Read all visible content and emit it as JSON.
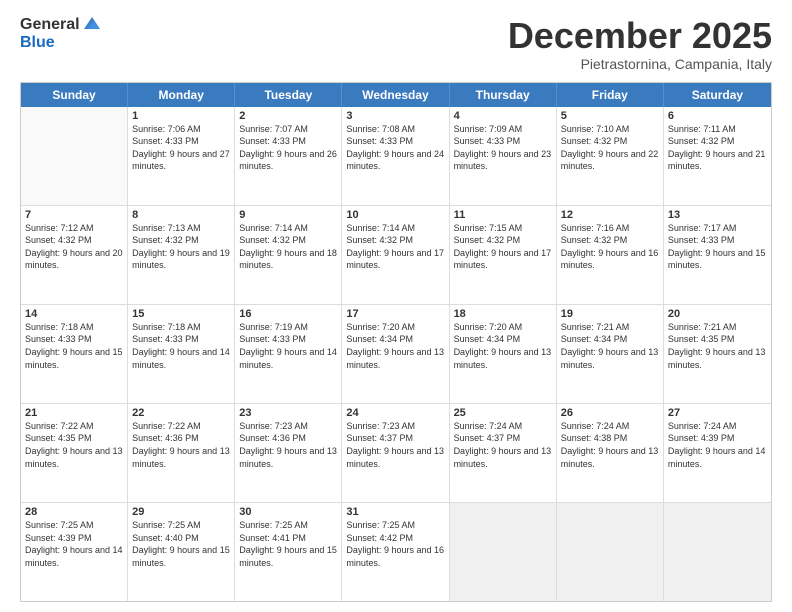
{
  "header": {
    "logo_general": "General",
    "logo_blue": "Blue",
    "month_title": "December 2025",
    "location": "Pietrastornina, Campania, Italy"
  },
  "days_of_week": [
    "Sunday",
    "Monday",
    "Tuesday",
    "Wednesday",
    "Thursday",
    "Friday",
    "Saturday"
  ],
  "weeks": [
    [
      {
        "day": "",
        "sunrise": "",
        "sunset": "",
        "daylight": "",
        "empty": true
      },
      {
        "day": "1",
        "sunrise": "Sunrise: 7:06 AM",
        "sunset": "Sunset: 4:33 PM",
        "daylight": "Daylight: 9 hours and 27 minutes."
      },
      {
        "day": "2",
        "sunrise": "Sunrise: 7:07 AM",
        "sunset": "Sunset: 4:33 PM",
        "daylight": "Daylight: 9 hours and 26 minutes."
      },
      {
        "day": "3",
        "sunrise": "Sunrise: 7:08 AM",
        "sunset": "Sunset: 4:33 PM",
        "daylight": "Daylight: 9 hours and 24 minutes."
      },
      {
        "day": "4",
        "sunrise": "Sunrise: 7:09 AM",
        "sunset": "Sunset: 4:33 PM",
        "daylight": "Daylight: 9 hours and 23 minutes."
      },
      {
        "day": "5",
        "sunrise": "Sunrise: 7:10 AM",
        "sunset": "Sunset: 4:32 PM",
        "daylight": "Daylight: 9 hours and 22 minutes."
      },
      {
        "day": "6",
        "sunrise": "Sunrise: 7:11 AM",
        "sunset": "Sunset: 4:32 PM",
        "daylight": "Daylight: 9 hours and 21 minutes."
      }
    ],
    [
      {
        "day": "7",
        "sunrise": "Sunrise: 7:12 AM",
        "sunset": "Sunset: 4:32 PM",
        "daylight": "Daylight: 9 hours and 20 minutes."
      },
      {
        "day": "8",
        "sunrise": "Sunrise: 7:13 AM",
        "sunset": "Sunset: 4:32 PM",
        "daylight": "Daylight: 9 hours and 19 minutes."
      },
      {
        "day": "9",
        "sunrise": "Sunrise: 7:14 AM",
        "sunset": "Sunset: 4:32 PM",
        "daylight": "Daylight: 9 hours and 18 minutes."
      },
      {
        "day": "10",
        "sunrise": "Sunrise: 7:14 AM",
        "sunset": "Sunset: 4:32 PM",
        "daylight": "Daylight: 9 hours and 17 minutes."
      },
      {
        "day": "11",
        "sunrise": "Sunrise: 7:15 AM",
        "sunset": "Sunset: 4:32 PM",
        "daylight": "Daylight: 9 hours and 17 minutes."
      },
      {
        "day": "12",
        "sunrise": "Sunrise: 7:16 AM",
        "sunset": "Sunset: 4:32 PM",
        "daylight": "Daylight: 9 hours and 16 minutes."
      },
      {
        "day": "13",
        "sunrise": "Sunrise: 7:17 AM",
        "sunset": "Sunset: 4:33 PM",
        "daylight": "Daylight: 9 hours and 15 minutes."
      }
    ],
    [
      {
        "day": "14",
        "sunrise": "Sunrise: 7:18 AM",
        "sunset": "Sunset: 4:33 PM",
        "daylight": "Daylight: 9 hours and 15 minutes."
      },
      {
        "day": "15",
        "sunrise": "Sunrise: 7:18 AM",
        "sunset": "Sunset: 4:33 PM",
        "daylight": "Daylight: 9 hours and 14 minutes."
      },
      {
        "day": "16",
        "sunrise": "Sunrise: 7:19 AM",
        "sunset": "Sunset: 4:33 PM",
        "daylight": "Daylight: 9 hours and 14 minutes."
      },
      {
        "day": "17",
        "sunrise": "Sunrise: 7:20 AM",
        "sunset": "Sunset: 4:34 PM",
        "daylight": "Daylight: 9 hours and 13 minutes."
      },
      {
        "day": "18",
        "sunrise": "Sunrise: 7:20 AM",
        "sunset": "Sunset: 4:34 PM",
        "daylight": "Daylight: 9 hours and 13 minutes."
      },
      {
        "day": "19",
        "sunrise": "Sunrise: 7:21 AM",
        "sunset": "Sunset: 4:34 PM",
        "daylight": "Daylight: 9 hours and 13 minutes."
      },
      {
        "day": "20",
        "sunrise": "Sunrise: 7:21 AM",
        "sunset": "Sunset: 4:35 PM",
        "daylight": "Daylight: 9 hours and 13 minutes."
      }
    ],
    [
      {
        "day": "21",
        "sunrise": "Sunrise: 7:22 AM",
        "sunset": "Sunset: 4:35 PM",
        "daylight": "Daylight: 9 hours and 13 minutes."
      },
      {
        "day": "22",
        "sunrise": "Sunrise: 7:22 AM",
        "sunset": "Sunset: 4:36 PM",
        "daylight": "Daylight: 9 hours and 13 minutes."
      },
      {
        "day": "23",
        "sunrise": "Sunrise: 7:23 AM",
        "sunset": "Sunset: 4:36 PM",
        "daylight": "Daylight: 9 hours and 13 minutes."
      },
      {
        "day": "24",
        "sunrise": "Sunrise: 7:23 AM",
        "sunset": "Sunset: 4:37 PM",
        "daylight": "Daylight: 9 hours and 13 minutes."
      },
      {
        "day": "25",
        "sunrise": "Sunrise: 7:24 AM",
        "sunset": "Sunset: 4:37 PM",
        "daylight": "Daylight: 9 hours and 13 minutes."
      },
      {
        "day": "26",
        "sunrise": "Sunrise: 7:24 AM",
        "sunset": "Sunset: 4:38 PM",
        "daylight": "Daylight: 9 hours and 13 minutes."
      },
      {
        "day": "27",
        "sunrise": "Sunrise: 7:24 AM",
        "sunset": "Sunset: 4:39 PM",
        "daylight": "Daylight: 9 hours and 14 minutes."
      }
    ],
    [
      {
        "day": "28",
        "sunrise": "Sunrise: 7:25 AM",
        "sunset": "Sunset: 4:39 PM",
        "daylight": "Daylight: 9 hours and 14 minutes."
      },
      {
        "day": "29",
        "sunrise": "Sunrise: 7:25 AM",
        "sunset": "Sunset: 4:40 PM",
        "daylight": "Daylight: 9 hours and 15 minutes."
      },
      {
        "day": "30",
        "sunrise": "Sunrise: 7:25 AM",
        "sunset": "Sunset: 4:41 PM",
        "daylight": "Daylight: 9 hours and 15 minutes."
      },
      {
        "day": "31",
        "sunrise": "Sunrise: 7:25 AM",
        "sunset": "Sunset: 4:42 PM",
        "daylight": "Daylight: 9 hours and 16 minutes."
      },
      {
        "day": "",
        "sunrise": "",
        "sunset": "",
        "daylight": "",
        "empty": true
      },
      {
        "day": "",
        "sunrise": "",
        "sunset": "",
        "daylight": "",
        "empty": true
      },
      {
        "day": "",
        "sunrise": "",
        "sunset": "",
        "daylight": "",
        "empty": true
      }
    ]
  ]
}
